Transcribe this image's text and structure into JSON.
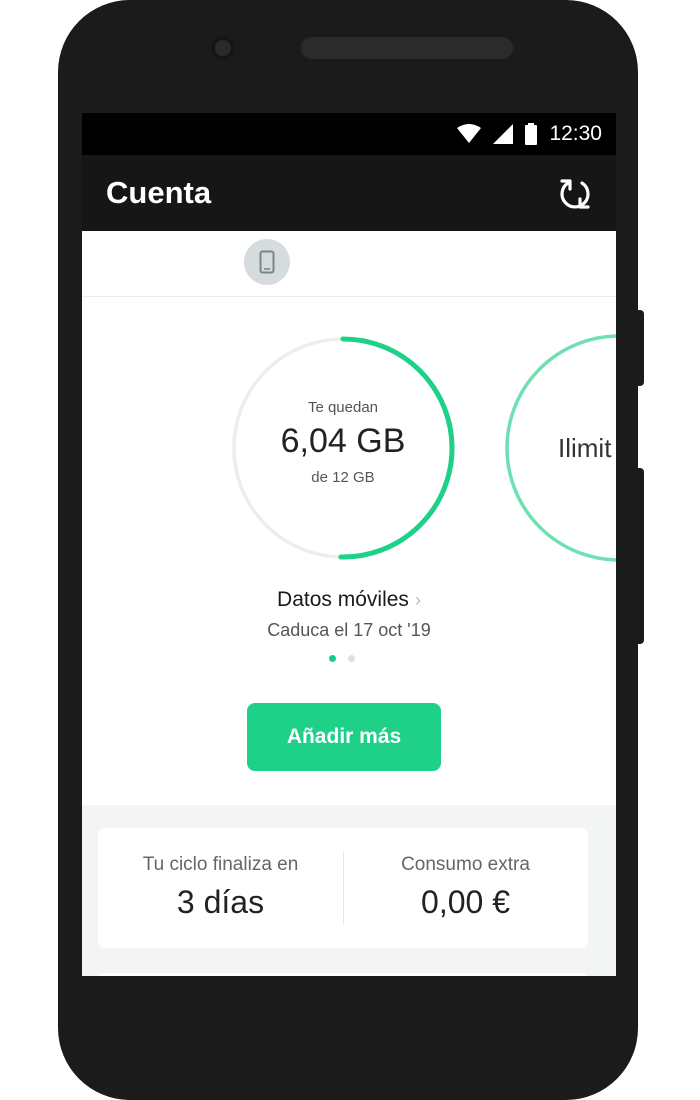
{
  "status": {
    "time": "12:30"
  },
  "appbar": {
    "title": "Cuenta"
  },
  "icons": {
    "wifi": "wifi-icon",
    "signal": "signal-icon",
    "battery": "battery-icon",
    "refresh": "refresh-icon",
    "device": "phone-device-icon",
    "chevron": "chevron-right-icon"
  },
  "data_card": {
    "label_top": "Te quedan",
    "remaining": "6,04 GB",
    "total": "de 12 GB",
    "remaining_fraction": 0.503,
    "title": "Datos móviles",
    "chevron": "›",
    "expiry": "Caduca el 17 oct '19"
  },
  "next_card": {
    "label": "Ilimit"
  },
  "pager": {
    "count": 2,
    "active": 0
  },
  "actions": {
    "add_more": "Añadir más"
  },
  "summary": {
    "cycle_label": "Tu ciclo finaliza en",
    "cycle_value": "3 días",
    "extra_label": "Consumo extra",
    "extra_value": "0,00 €"
  },
  "colors": {
    "accent": "#1ed088",
    "ring_track": "#ededed",
    "appbar": "#161616"
  }
}
